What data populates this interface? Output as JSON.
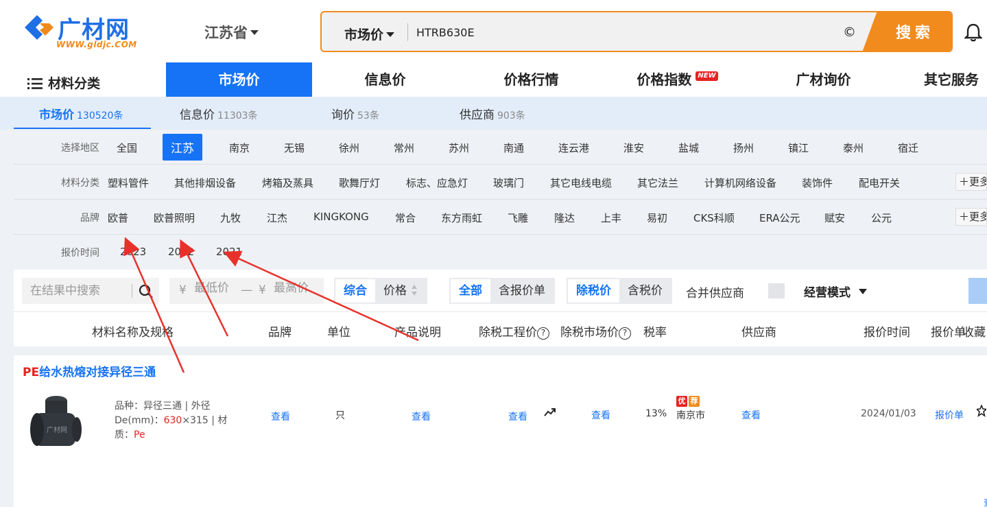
{
  "logo": {
    "name": "广材网",
    "url": "WWW.gldjc.COM"
  },
  "region": "江苏省",
  "search": {
    "scope": "市场价",
    "query": "HTRB630E",
    "button": "搜索",
    "clear_icon": "copyright-like-clear-icon"
  },
  "nav": {
    "categories": "材料分类",
    "items": [
      "市场价",
      "信息价",
      "价格行情",
      "价格指数",
      "广材询价",
      "其它服务"
    ],
    "new_badge": "NEW"
  },
  "subtabs": [
    {
      "label": "市场价",
      "count": "130520条"
    },
    {
      "label": "信息价",
      "count": "11303条"
    },
    {
      "label": "询价",
      "count": "53条"
    },
    {
      "label": "供应商",
      "count": "903条"
    }
  ],
  "filters": {
    "region": {
      "label": "选择地区",
      "options": [
        "全国",
        "江苏",
        "南京",
        "无锡",
        "徐州",
        "常州",
        "苏州",
        "南通",
        "连云港",
        "淮安",
        "盐城",
        "扬州",
        "镇江",
        "泰州",
        "宿迁"
      ]
    },
    "category": {
      "label": "材料分类",
      "options": [
        "塑料管件",
        "其他排烟设备",
        "烤箱及蒸具",
        "歌舞厅灯",
        "标志、应急灯",
        "玻璃门",
        "其它电线电缆",
        "其它法兰",
        "计算机网络设备",
        "装饰件",
        "配电开关"
      ]
    },
    "brand": {
      "label": "品牌",
      "options": [
        "欧普",
        "欧普照明",
        "九牧",
        "江杰",
        "KINGKONG",
        "常合",
        "东方雨虹",
        "飞雕",
        "隆达",
        "上丰",
        "易初",
        "CKS科顺",
        "ERA公元",
        "赋安",
        "公元"
      ]
    },
    "time": {
      "label": "报价时间",
      "options": [
        "2023",
        "2022",
        "2021"
      ]
    },
    "more": "更多"
  },
  "toolbar": {
    "search_placeholder": "在结果中搜索",
    "price_min_placeholder": "最低价",
    "price_max_placeholder": "最高价",
    "currency": "¥",
    "dash": "—",
    "sort": [
      "综合",
      "价格"
    ],
    "quote": [
      "全部",
      "含报价单"
    ],
    "tax": [
      "除税价",
      "含税价"
    ],
    "merge": "合并供应商",
    "mode": "经营模式"
  },
  "table": {
    "headers": [
      "材料名称及规格",
      "品牌",
      "单位",
      "产品说明",
      "除税工程价",
      "除税市场价",
      "税率",
      "供应商",
      "报价时间",
      "报价单",
      "收藏"
    ]
  },
  "row": {
    "title_prefix": "PE",
    "title_rest": "给水热熔对接异径三通",
    "image_watermark": "广材网",
    "desc1": "品种：异径三通 | 外径",
    "desc2_pre": "De(mm)：",
    "desc2_val": "630",
    "desc2_post": "×315 | 材",
    "desc3_pre": "质：",
    "desc3_val": "Pe",
    "brand": "查看",
    "unit": "只",
    "note": "查看",
    "eng_price": "查看",
    "market_price": "查看",
    "tax": "13%",
    "badge1": "优",
    "badge2": "荐",
    "city": "南京市",
    "supplier": "查看",
    "date": "2024/01/03",
    "quote": "报价单",
    "corner": "查"
  },
  "colors": {
    "brand_blue": "#1673f5",
    "search_orange": "#f28b1e",
    "red": "#e62222"
  }
}
